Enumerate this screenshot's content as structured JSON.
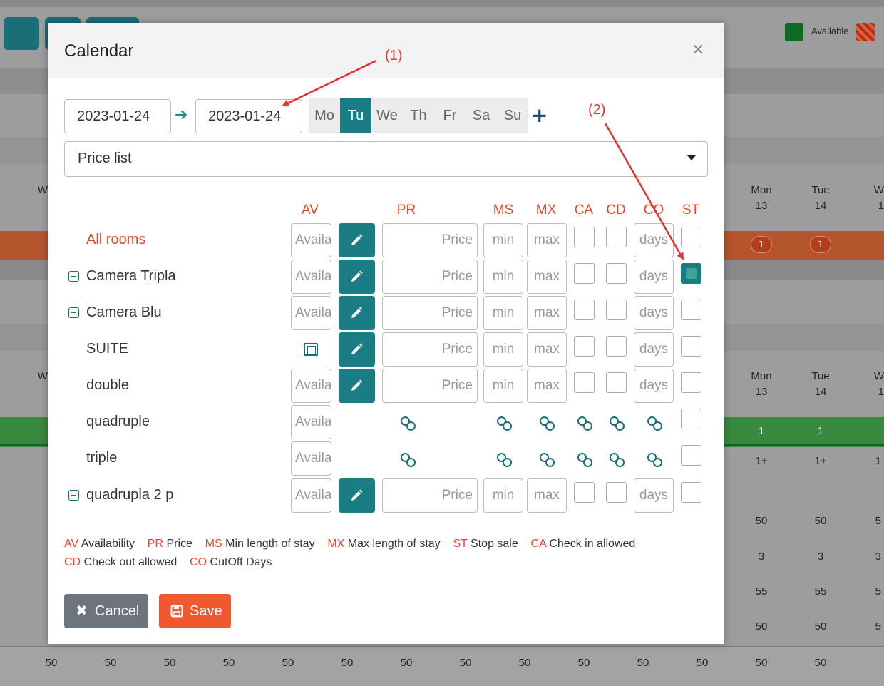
{
  "modal": {
    "title": "Calendar",
    "date_from": "2023-01-24",
    "date_to": "2023-01-24",
    "weekdays": [
      {
        "label": "Mo",
        "active": false
      },
      {
        "label": "Tu",
        "active": true
      },
      {
        "label": "We",
        "active": false
      },
      {
        "label": "Th",
        "active": false
      },
      {
        "label": "Fr",
        "active": false
      },
      {
        "label": "Sa",
        "active": false
      },
      {
        "label": "Su",
        "active": false
      }
    ],
    "price_list": "Price list",
    "columns": [
      "AV",
      "PR",
      "MS",
      "MX",
      "CA",
      "CD",
      "CO",
      "ST"
    ],
    "placeholders": {
      "av": "Availability",
      "pr": "Price",
      "ms": "min",
      "mx": "max",
      "co": "days"
    },
    "rows": [
      {
        "name": "All rooms",
        "type": "full",
        "collapsible": false,
        "st_checked": false
      },
      {
        "name": "Camera Tripla",
        "type": "full",
        "collapsible": true,
        "st_checked": true
      },
      {
        "name": "Camera Blu",
        "type": "full",
        "collapsible": true,
        "st_checked": false
      },
      {
        "name": "SUITE",
        "type": "no-av",
        "collapsible": false,
        "st_checked": false
      },
      {
        "name": "double",
        "type": "full",
        "collapsible": false,
        "st_checked": false
      },
      {
        "name": "quadruple",
        "type": "linked",
        "collapsible": false,
        "st_checked": false
      },
      {
        "name": "triple",
        "type": "linked",
        "collapsible": false,
        "st_checked": false
      },
      {
        "name": "quadrupla 2 p",
        "type": "full",
        "collapsible": true,
        "st_checked": false
      }
    ],
    "legend": [
      {
        "abbr": "AV",
        "text": "Availability"
      },
      {
        "abbr": "PR",
        "text": "Price"
      },
      {
        "abbr": "MS",
        "text": "Min length of stay"
      },
      {
        "abbr": "MX",
        "text": "Max length of stay"
      },
      {
        "abbr": "ST",
        "text": "Stop sale"
      },
      {
        "abbr": "CA",
        "text": "Check in allowed"
      },
      {
        "abbr": "CD",
        "text": "Check out allowed"
      },
      {
        "abbr": "CO",
        "text": "CutOff Days"
      }
    ],
    "cancel_label": "Cancel",
    "save_label": "Save"
  },
  "annotations": {
    "one": "(1)",
    "two": "(2)"
  },
  "background": {
    "legend_available": "Available",
    "day_headers": [
      {
        "day": "Mon",
        "num": "13"
      },
      {
        "day": "Tue",
        "num": "14"
      },
      {
        "day": "W",
        "num": "1"
      }
    ],
    "header_row_left": "W",
    "circle_values": [
      "1",
      "1"
    ],
    "green_values": [
      "1",
      "1"
    ],
    "row_values": [
      [
        "1+",
        "1+",
        "1"
      ],
      [
        "50",
        "50",
        "5"
      ],
      [
        "3",
        "3",
        "3"
      ],
      [
        "55",
        "55",
        "5"
      ],
      [
        "50",
        "50",
        "5"
      ]
    ],
    "bottom_row": [
      "50",
      "50",
      "50",
      "50",
      "50",
      "50",
      "50",
      "50",
      "50",
      "50",
      "50",
      "50",
      "50",
      "50",
      "50"
    ]
  },
  "colors": {
    "teal": "#1a7d85",
    "orange": "#f0582f",
    "red_label": "#e8462a",
    "gray_button": "#6c757d"
  }
}
